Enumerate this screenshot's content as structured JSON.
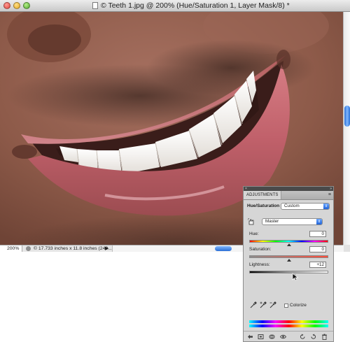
{
  "window": {
    "title": "© Teeth 1.jpg @ 200% (Hue/Saturation 1, Layer Mask/8) *"
  },
  "status": {
    "zoom": "200%",
    "doc_info": "© 17.733 inches x 11.8 inches (240...",
    "menu_arrow": "▶"
  },
  "panel": {
    "tab": "ADJUSTMENTS",
    "close_glyph": "×",
    "collapse_glyph": "»",
    "menu_glyph": "≡",
    "adjustment_name": "Hue/Saturation",
    "preset": "Custom",
    "channel": "Master",
    "hue_label": "Hue:",
    "hue_value": "0",
    "saturation_label": "Saturation:",
    "saturation_value": "0",
    "lightness_label": "Lightness:",
    "lightness_value": "+12",
    "colorize_label": "Colorize",
    "dropdown_arrow": "⇕"
  },
  "colors": {
    "accent": "#2a6fd6",
    "panel_bg": "#d6d6d6",
    "panel_header": "#4a4a4a"
  },
  "icons": [
    "close-icon",
    "minimize-icon",
    "zoom-icon",
    "document-icon",
    "on-image-adjust-icon",
    "eyedropper-icon",
    "eyedropper-plus-icon",
    "eyedropper-minus-icon",
    "back-arrow-icon",
    "expand-view-icon",
    "clip-layer-icon",
    "visibility-eye-icon",
    "previous-state-icon",
    "reset-icon",
    "trash-icon"
  ]
}
